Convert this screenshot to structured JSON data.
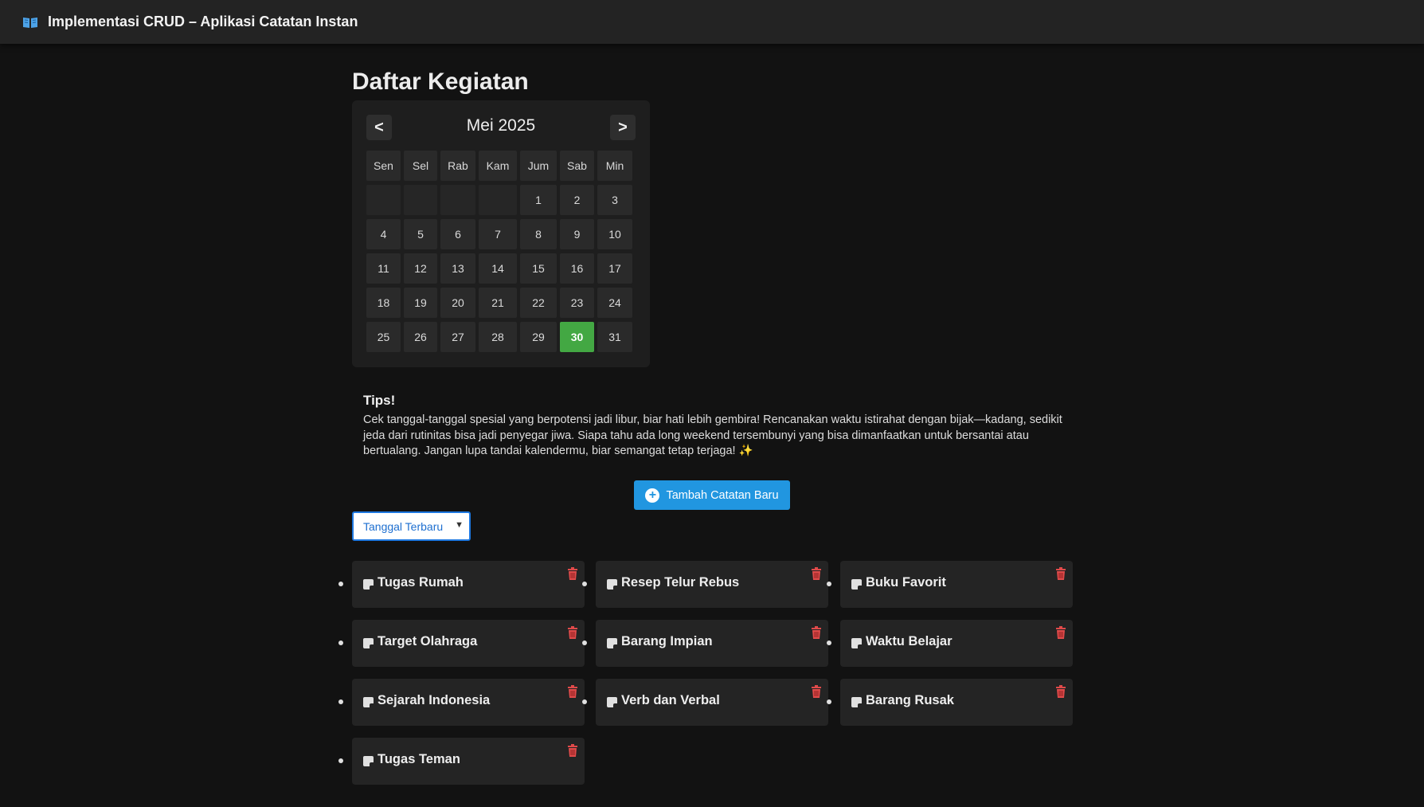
{
  "header": {
    "title": "Implementasi CRUD – Aplikasi Catatan Instan",
    "icon": "open-book-icon"
  },
  "page": {
    "title": "Daftar Kegiatan"
  },
  "calendar": {
    "prev_label": "<",
    "next_label": ">",
    "month_label": "Mei 2025",
    "weekdays": [
      "Sen",
      "Sel",
      "Rab",
      "Kam",
      "Jum",
      "Sab",
      "Min"
    ],
    "leading_empty": 4,
    "days_in_month": 31,
    "today": 30,
    "today_color": "#43a843"
  },
  "tips": {
    "title": "Tips!",
    "text": "Cek tanggal-tanggal spesial yang berpotensi jadi libur, biar hati lebih gembira! Rencanakan waktu istirahat dengan bijak—kadang, sedikit jeda dari rutinitas bisa jadi penyegar jiwa. Siapa tahu ada long weekend tersembunyi yang bisa dimanfaatkan untuk bersantai atau bertualang. Jangan lupa tandai kalendermu, biar semangat tetap terjaga! ✨"
  },
  "actions": {
    "add_note_label": "Tambah Catatan Baru",
    "accent": "#2196e0"
  },
  "sort": {
    "selected": "Tanggal Terbaru"
  },
  "notes": [
    "Tugas Rumah",
    "Resep Telur Rebus",
    "Buku Favorit",
    "Target Olahraga",
    "Barang Impian",
    "Waktu Belajar",
    "Sejarah Indonesia",
    "Verb dan Verbal",
    "Barang Rusak",
    "Tugas Teman"
  ]
}
